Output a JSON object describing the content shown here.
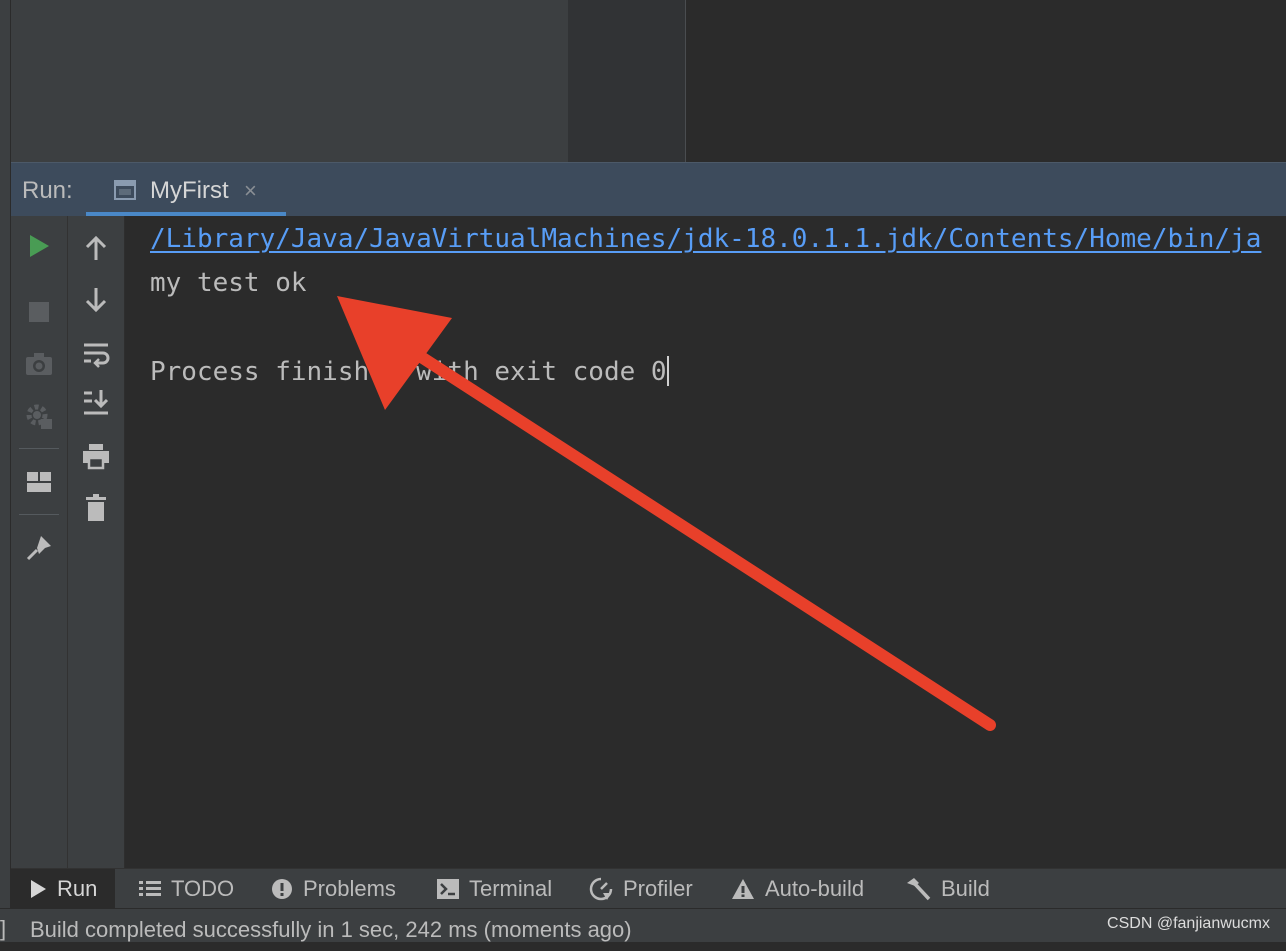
{
  "run_window": {
    "label": "Run:",
    "tab": {
      "title": "MyFirst",
      "close_glyph": "×",
      "icon": "console-window-icon"
    }
  },
  "toolbar_left": [
    {
      "icon": "rerun-icon",
      "color": "#499c54"
    },
    {
      "icon": "stop-icon"
    },
    {
      "icon": "camera-icon"
    },
    {
      "icon": "debug-gear-icon"
    },
    {
      "icon": "layout-icon"
    },
    {
      "icon": "pin-icon"
    }
  ],
  "toolbar_right": [
    {
      "icon": "arrow-up-icon"
    },
    {
      "icon": "arrow-down-icon"
    },
    {
      "icon": "soft-wrap-icon"
    },
    {
      "icon": "scroll-to-end-icon"
    },
    {
      "icon": "print-icon"
    },
    {
      "icon": "trash-icon"
    }
  ],
  "console": {
    "path_line": "/Library/Java/JavaVirtualMachines/jdk-18.0.1.1.jdk/Contents/Home/bin/ja",
    "output_line": "my test ok",
    "exit_line": "Process finished with exit code 0"
  },
  "bottom_tabs": [
    {
      "label": "Run",
      "icon": "play-icon",
      "active": true
    },
    {
      "label": "TODO",
      "icon": "list-icon"
    },
    {
      "label": "Problems",
      "icon": "problems-icon"
    },
    {
      "label": "Terminal",
      "icon": "terminal-icon"
    },
    {
      "label": "Profiler",
      "icon": "profiler-icon"
    },
    {
      "label": "Auto-build",
      "icon": "warning-icon"
    },
    {
      "label": "Build",
      "icon": "hammer-icon"
    }
  ],
  "status_bar": {
    "bracket": "]",
    "message": "Build completed successfully in 1 sec, 242 ms (moments ago)",
    "watermark": "CSDN @fanjianwucmx"
  },
  "colors": {
    "link": "#589df6",
    "accent": "#4a88c7",
    "annotation_arrow": "#e8402a"
  }
}
